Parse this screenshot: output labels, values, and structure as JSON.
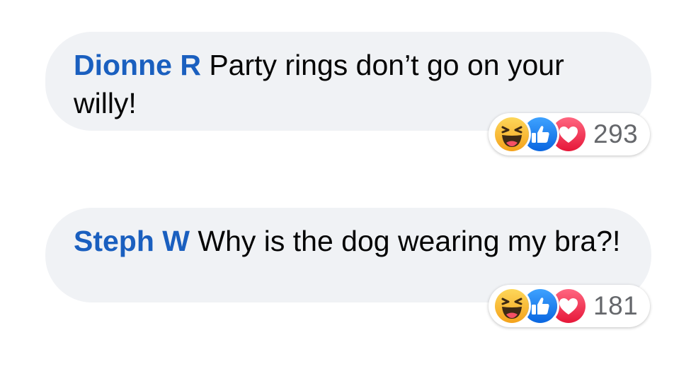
{
  "comments": [
    {
      "author": "Dionne R",
      "text": " Party rings don’t go on your willy!",
      "reaction_count": "293",
      "reactions": [
        "haha-icon",
        "like-icon",
        "love-icon"
      ]
    },
    {
      "author": "Steph W",
      "text": " Why is the dog wearing my bra?!",
      "reaction_count": "181",
      "reactions": [
        "haha-icon",
        "like-icon",
        "love-icon"
      ]
    }
  ],
  "colors": {
    "bubble": "#f0f2f5",
    "author": "#1a5fbf",
    "like": "#1877f2",
    "love": "#f33e58",
    "haha": "#f7b125"
  }
}
